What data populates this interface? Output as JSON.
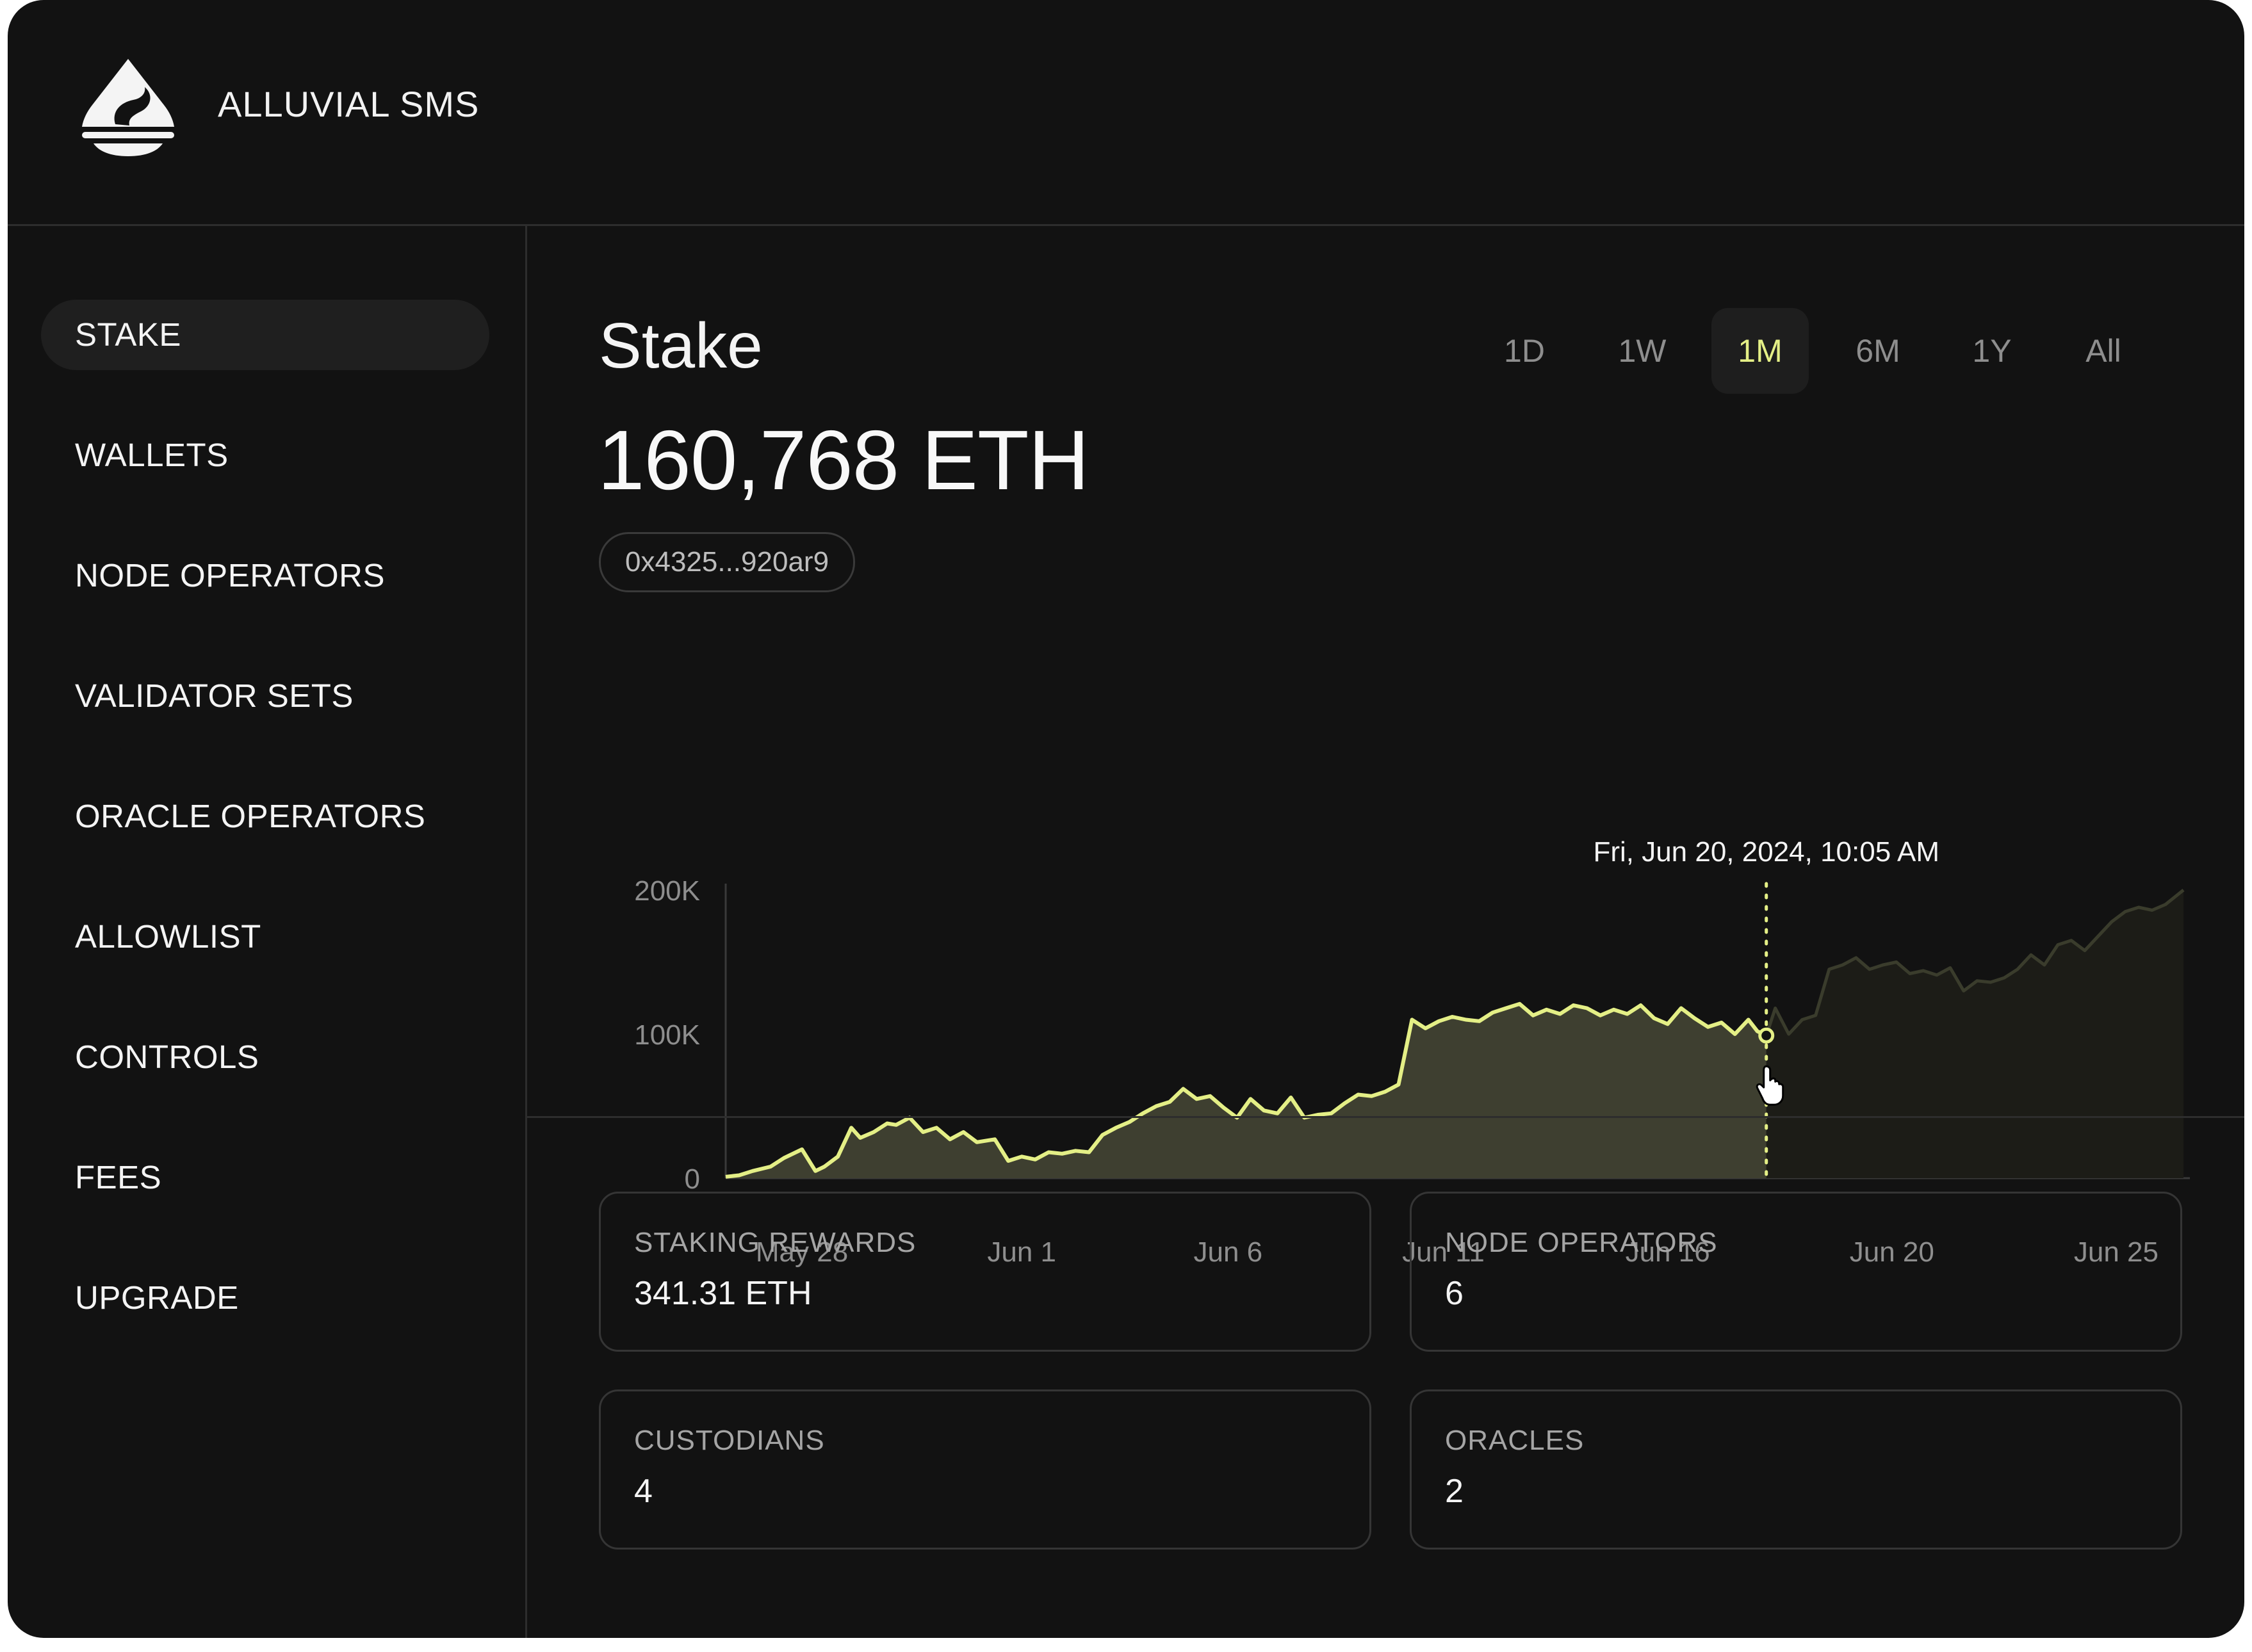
{
  "header": {
    "brand": "ALLUVIAL SMS",
    "logo_icon": "alluvial-drop-icon"
  },
  "sidebar": {
    "items": [
      {
        "label": "STAKE",
        "active": true
      },
      {
        "label": "WALLETS"
      },
      {
        "label": "NODE OPERATORS"
      },
      {
        "label": "VALIDATOR SETS"
      },
      {
        "label": "ORACLE OPERATORS"
      },
      {
        "label": "ALLOWLIST"
      },
      {
        "label": "CONTROLS"
      },
      {
        "label": "FEES"
      },
      {
        "label": "UPGRADE"
      }
    ]
  },
  "main": {
    "title": "Stake",
    "value": "160,768 ETH",
    "address": "0x4325...920ar9",
    "ranges": [
      "1D",
      "1W",
      "1M",
      "6M",
      "1Y",
      "All"
    ],
    "active_range": "1M"
  },
  "colors": {
    "accent": "#e4ef86",
    "area_fill": "#3e3f30",
    "area_fill_future": "#1c1c17",
    "background": "#121212",
    "border": "#2d2d2d"
  },
  "chart_data": {
    "type": "area",
    "tooltip": "Fri, Jun 20, 2024, 10:05 AM",
    "hover_day": 23.2,
    "y_ticks": [
      "200K",
      "100K",
      "0"
    ],
    "ylim": [
      0,
      200000
    ],
    "xlim": [
      0,
      32.5
    ],
    "x_ticks": [
      {
        "day": 1.7,
        "label": "May 28"
      },
      {
        "day": 6.6,
        "label": "Jun 1"
      },
      {
        "day": 11.2,
        "label": "Jun 6"
      },
      {
        "day": 16.0,
        "label": "Jun 11"
      },
      {
        "day": 21.0,
        "label": "Jun 16"
      },
      {
        "day": 26.0,
        "label": "Jun 20"
      },
      {
        "day": 31.0,
        "label": "Jun 25"
      }
    ],
    "series": [
      {
        "x": [
          0,
          0.3,
          0.6,
          1.0,
          1.3,
          1.7,
          2.0,
          2.2,
          2.5,
          2.8,
          3.0,
          3.3,
          3.6,
          3.8,
          4.1,
          4.4,
          4.7,
          5.0,
          5.3,
          5.6,
          6.0,
          6.3,
          6.6,
          6.9,
          7.2,
          7.5,
          7.8,
          8.1,
          8.4,
          8.7,
          9.0,
          9.3,
          9.6,
          9.9,
          10.2,
          10.5,
          10.8,
          11.1,
          11.4,
          11.7,
          12.0,
          12.3,
          12.6,
          12.9,
          13.2,
          13.5,
          13.8,
          14.1,
          14.4,
          14.7,
          15.0,
          15.3,
          15.6,
          15.9,
          16.2,
          16.5,
          16.8,
          17.1,
          17.4,
          17.7,
          18.0,
          18.3,
          18.6,
          18.9,
          19.2,
          19.5,
          19.8,
          20.1,
          20.4,
          20.7,
          21.0,
          21.3,
          21.6,
          21.9,
          22.2,
          22.5,
          22.8,
          23.0,
          23.2,
          23.4,
          23.7,
          24.0,
          24.3,
          24.6,
          24.9,
          25.2,
          25.5,
          25.8,
          26.1,
          26.4,
          26.7,
          27.0,
          27.3,
          27.6,
          27.9,
          28.2,
          28.5,
          28.8,
          29.1,
          29.4,
          29.7,
          30.0,
          30.3,
          30.6,
          30.9,
          31.2,
          31.5,
          31.8,
          32.1,
          32.5
        ],
        "y": [
          1000,
          2000,
          5000,
          8000,
          14000,
          20000,
          5000,
          8000,
          15000,
          35000,
          28000,
          32000,
          38000,
          37000,
          42000,
          32000,
          35000,
          27000,
          32000,
          25000,
          27000,
          12000,
          15000,
          13000,
          18000,
          17000,
          19000,
          18000,
          30000,
          35000,
          39000,
          45000,
          50000,
          53000,
          62000,
          55000,
          57000,
          49000,
          42000,
          55000,
          47000,
          45000,
          56000,
          42000,
          44000,
          45000,
          52000,
          58000,
          57000,
          60000,
          65000,
          110000,
          104000,
          109000,
          112000,
          110000,
          109000,
          115000,
          118000,
          121000,
          113000,
          117000,
          114000,
          120000,
          118000,
          113000,
          117000,
          114000,
          120000,
          111000,
          107000,
          118000,
          111000,
          105000,
          108000,
          100000,
          110000,
          102000,
          99000,
          118000,
          100000,
          110000,
          113000,
          145000,
          148000,
          153000,
          145000,
          148000,
          150000,
          142000,
          144000,
          141000,
          146000,
          130000,
          137000,
          136000,
          139000,
          145000,
          155000,
          148000,
          162000,
          165000,
          158000,
          168000,
          178000,
          185000,
          188000,
          186000,
          190000,
          200000
        ]
      }
    ]
  },
  "stats": [
    {
      "label": "STAKING REWARDS",
      "value": "341.31 ETH"
    },
    {
      "label": "NODE OPERATORS",
      "value": "6"
    },
    {
      "label": "CUSTODIANS",
      "value": "4"
    },
    {
      "label": "ORACLES",
      "value": "2"
    }
  ]
}
